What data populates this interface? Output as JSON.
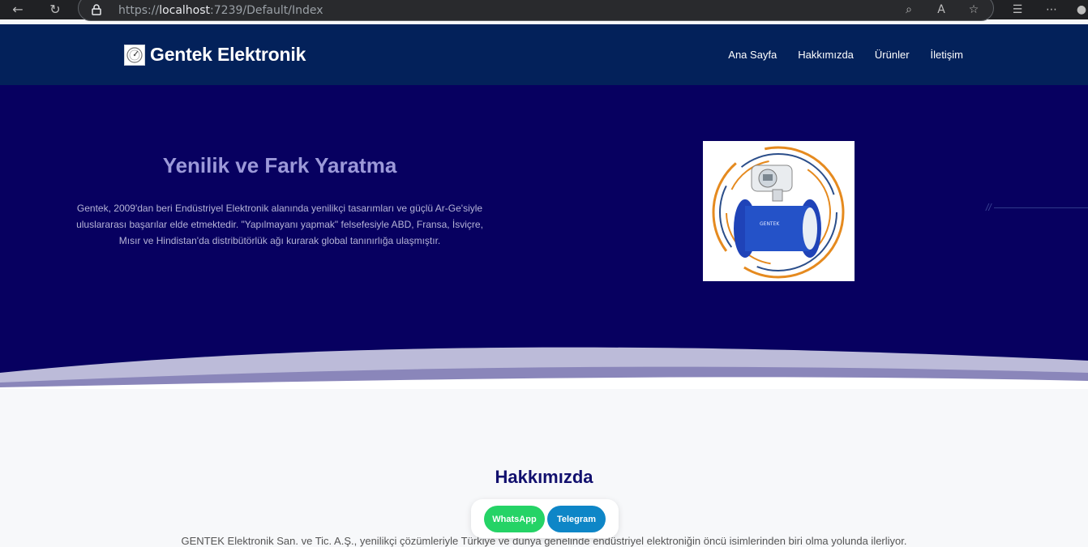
{
  "browser": {
    "url_scheme": "https://",
    "url_host": "localhost",
    "url_rest": ":7239/Default/Index"
  },
  "navbar": {
    "brand": "Gentek Elektronik",
    "menu": [
      "Ana Sayfa",
      "Hakkımızda",
      "Ürünler",
      "İletişim"
    ]
  },
  "hero": {
    "title": "Yenilik ve Fark Yaratma",
    "text": "Gentek, 2009'dan beri Endüstriyel Elektronik alanında yenilikçi tasarımları ve güçlü Ar-Ge'siyle uluslararası başarılar elde etmektedir. \"Yapılmayanı yapmak\" felsefesiyle ABD, Fransa, İsviçre, Mısır ve Hindistan'da distribütörlük ağı kurarak global tanınırlığa ulaşmıştır.",
    "device_label": "GENTEK"
  },
  "about": {
    "title": "Hakkımızda",
    "text": "GENTEK Elektronik San. ve Tic. A.Ş., yenilikçi çözümleriyle Türkiye ve dünya genelinde endüstriyel elektroniğin öncü isimlerinden biri olma yolunda ilerliyor."
  },
  "floating": {
    "whatsapp": "WhatsApp",
    "telegram": "Telegram"
  },
  "colors": {
    "navbar": "#03215a",
    "hero": "#070060",
    "whatsapp": "#25d366",
    "telegram": "#0e86c7"
  }
}
